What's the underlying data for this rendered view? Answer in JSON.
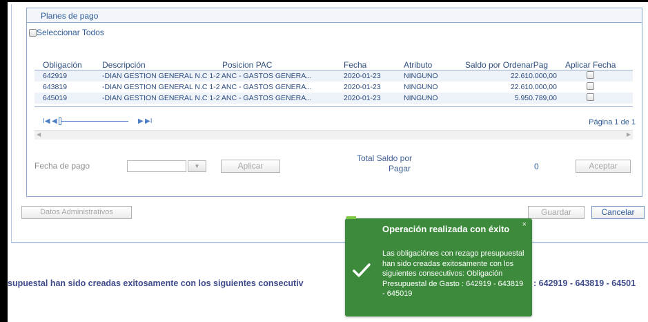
{
  "panel": {
    "title": "Planes de pago",
    "select_all_label": "Seleccionar Todos"
  },
  "grid": {
    "columns": [
      "Obligación",
      "Descripción",
      "Posicion PAC",
      "Fecha",
      "Atributo",
      "Saldo por OrdenarPag",
      "Aplicar Fecha"
    ],
    "rows": [
      {
        "obligacion": "642919",
        "descripcion": "-DIAN GESTION GENERAL N.C 1-2 ANC - GASTOS GENERA...",
        "fecha": "2020-01-23",
        "atributo": "NINGUNO",
        "saldo": "22.610.000,00",
        "aplicar": false
      },
      {
        "obligacion": "643819",
        "descripcion": "-DIAN GESTION GENERAL N.C 1-2 ANC - GASTOS GENERA...",
        "fecha": "2020-01-23",
        "atributo": "NINGUNO",
        "saldo": "22.610.000,00",
        "aplicar": false
      },
      {
        "obligacion": "645019",
        "descripcion": "-DIAN GESTION GENERAL N.C 1-2 ANC - GASTOS GENERA...",
        "fecha": "2020-01-23",
        "atributo": "NINGUNO",
        "saldo": "5.950.789,00",
        "aplicar": false
      }
    ],
    "pager": {
      "first": "I◀",
      "prev": "◀",
      "next": "▶",
      "last": "▶I",
      "page_text": "Página 1 de 1"
    }
  },
  "payment": {
    "fecha_label": "Fecha de pago",
    "fecha_value": "",
    "dropdown_icon": "▼",
    "aplicar_label": "Aplicar",
    "total_label_line1": "Total Saldo por",
    "total_label_line2": "Pagar",
    "total_value": "0",
    "aceptar_label": "Aceptar"
  },
  "footer": {
    "datos_label": "Datos Administrativos",
    "guardar_label": "Guardar",
    "cancelar_label": "Cancelar"
  },
  "marquee": {
    "left_text": "supuestal han sido creadas exitosamente con los siguientes consecutiv",
    "right_text": ": 642919 - 643819 - 64501"
  },
  "toast": {
    "close": "×",
    "title": "Operación realizada con éxito",
    "message": "Las obligaciónes con rezago presupuestal han sido creadas exitosamente con los siguientes consecutivos: Obligación Presupuestal de Gasto : 642919 - 643819 - 645019"
  },
  "colors": {
    "accent": "#2f5c9a",
    "toast_bg": "#3d8a3d",
    "border": "#8eaad1"
  }
}
